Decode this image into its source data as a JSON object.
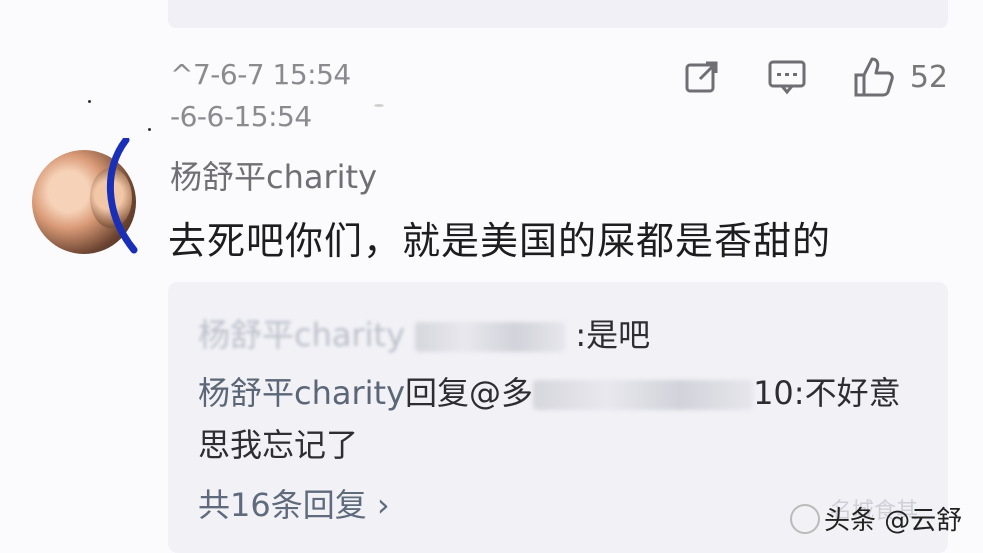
{
  "post": {
    "time_1": "^7-6-7 15:54",
    "time_2": "-6-6-15:54",
    "like_count": "52"
  },
  "comment": {
    "username": "杨舒平charity",
    "text": "去死吧你们，就是美国的屎都是香甜的"
  },
  "replies": {
    "line1_user": "杨舒平charity",
    "line1_suffix": ":是吧",
    "line2_user": "杨舒平charity",
    "line2_mid": "回复@",
    "line2_partial": "多",
    "line2_tail": "10:不好意",
    "line3": "思我忘记了",
    "more_label": "共16条回复 ›"
  },
  "watermark": {
    "text": "头条 @云舒",
    "faint": "名城食其"
  },
  "colors": {
    "background": "#fbfbfd",
    "reply_bg": "#f1f1f6",
    "meta_gray": "#8a8a8f",
    "user_blue_gray": "#5b6677"
  }
}
